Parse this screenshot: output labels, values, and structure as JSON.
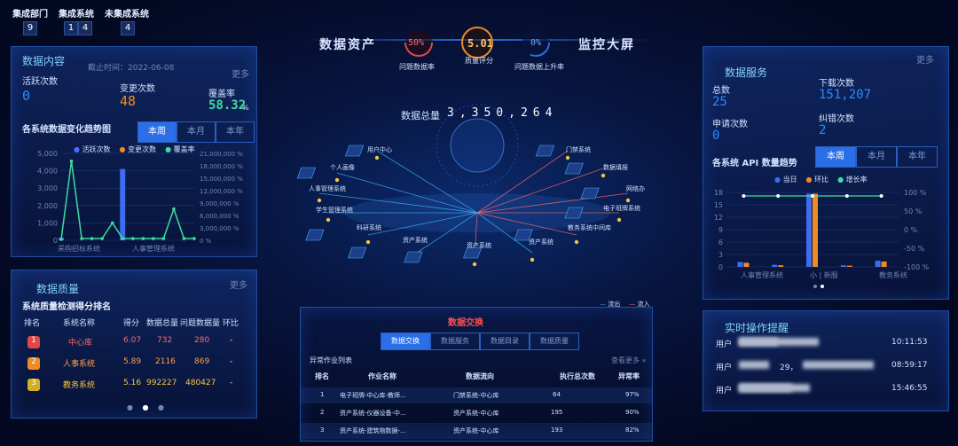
{
  "colors": {
    "accent": "#2a6fe8",
    "cyan": "#7fd4ff",
    "orange": "#f08a24",
    "green": "#3fdca0",
    "red": "#e04848",
    "yellow": "#f5c542"
  },
  "top_stats": {
    "labels": [
      "集成部门",
      "集成系统",
      "未集成系统"
    ],
    "dept_count": "9",
    "system_digits": [
      "1",
      "4"
    ],
    "unintegrated": "4"
  },
  "header": {
    "left_title": "数据资产",
    "right_title": "监控大屏",
    "gauges": [
      {
        "value": "50%",
        "label": "问题数据率"
      },
      {
        "value": "5.01",
        "label": "质量评分"
      },
      {
        "value": "0%",
        "label": "问题数据上升率"
      }
    ]
  },
  "data_content": {
    "title": "数据内容",
    "date": "截止时间：2022-06-08",
    "more": "更多",
    "active_label": "活跃次数",
    "active_value": "0",
    "change_label": "变更次数",
    "change_value": "48",
    "coverage_label": "覆盖率",
    "coverage_value": "58.32",
    "coverage_unit": "%",
    "trend_title": "各系统数据变化趋势图",
    "tabs": [
      "本周",
      "本月",
      "本年"
    ],
    "legend": [
      "活跃次数",
      "变更次数",
      "覆盖率"
    ]
  },
  "chart_data": [
    {
      "type": "line",
      "title": "各系统数据变化趋势图",
      "y_ticks_left": [
        "5,000",
        "4,000",
        "3,000",
        "2,000",
        "1,000",
        "0"
      ],
      "y_ticks_right": [
        "21,000,000 %",
        "18,000,000 %",
        "15,000,000 %",
        "12,000,000 %",
        "9,000,000 %",
        "6,000,000 %",
        "3,000,000 %",
        "0 %"
      ],
      "x_labels": [
        "采购招标系统",
        "人事管理系统"
      ],
      "ylim": [
        0,
        5000
      ],
      "series": [
        {
          "name": "活跃次数",
          "type": "bar",
          "values": [
            0,
            0,
            0,
            0,
            0,
            0,
            0,
            0,
            0,
            0,
            0,
            0,
            0,
            0
          ]
        },
        {
          "name": "变更次数",
          "type": "bar",
          "values": [
            150,
            0,
            0,
            0,
            0,
            0,
            4100,
            0,
            0,
            0,
            0,
            0,
            0,
            0
          ]
        },
        {
          "name": "覆盖率",
          "type": "line",
          "values": [
            50,
            4550,
            100,
            100,
            100,
            1000,
            100,
            100,
            100,
            100,
            100,
            1800,
            100,
            100
          ]
        }
      ]
    },
    {
      "type": "bar",
      "title": "各系统 API 数量趋势",
      "y_ticks_left": [
        "18",
        "15",
        "12",
        "9",
        "6",
        "3",
        "0"
      ],
      "y_ticks_right": [
        "100 %",
        "50 %",
        "0 %",
        "-50 %",
        "-100 %"
      ],
      "x_labels": [
        "人事管理系统",
        "小 | 新服",
        "教务系统"
      ],
      "ylim": [
        0,
        18
      ],
      "series": [
        {
          "name": "当日",
          "values": [
            1.2,
            0.5,
            17.7,
            0.4,
            1.5
          ]
        },
        {
          "name": "环比",
          "values": [
            1.0,
            0.4,
            17.7,
            0.3,
            1.3
          ]
        },
        {
          "name": "增长率",
          "type": "line",
          "values": [
            100,
            100,
            100,
            100,
            100
          ]
        }
      ]
    }
  ],
  "quality": {
    "title": "数据质量",
    "more": "更多",
    "subtitle": "系统质量检测得分排名",
    "columns": [
      "排名",
      "系统名称",
      "得分",
      "数据总量",
      "问题数据量",
      "环比"
    ],
    "rows": [
      {
        "rank": "1",
        "name": "中心库",
        "score": "6.07",
        "total": "732",
        "issue": "280",
        "ratio": "-"
      },
      {
        "rank": "2",
        "name": "人事系统",
        "score": "5.89",
        "total": "2116",
        "issue": "869",
        "ratio": "-"
      },
      {
        "rank": "3",
        "name": "教务系统",
        "score": "5.16",
        "total": "992227",
        "issue": "480427",
        "ratio": "-"
      }
    ]
  },
  "center": {
    "total_label": "数据总量",
    "total_value": "3,350,264",
    "nodes": [
      "用户中心",
      "门禁系统",
      "个人画像",
      "数据填报",
      "人事管理系统",
      "网络办",
      "学生管理系统",
      "电子班牌系统",
      "科研系统",
      "教务系统中间库",
      "资产系统",
      "资产系统",
      "资产系统",
      "资产系统"
    ],
    "legend": [
      "流出",
      "流入"
    ]
  },
  "bottom": {
    "banner": "数据交换",
    "tabs": [
      "数据交换",
      "数据服务",
      "数据目录",
      "数据质量"
    ],
    "list_title": "异常作业列表",
    "more": "查看更多 »",
    "columns": [
      "排名",
      "作业名称",
      "数据流向",
      "执行总次数",
      "异常率"
    ],
    "rows": [
      {
        "rank": "1",
        "name": "电子班牌-中心库-教师...",
        "flow": "门禁系统-中心库",
        "count": "64",
        "rate": "97%"
      },
      {
        "rank": "2",
        "name": "资产系统-仪器设备-中...",
        "flow": "资产系统-中心库",
        "count": "195",
        "rate": "90%"
      },
      {
        "rank": "3",
        "name": "资产系统-建筑物数据-...",
        "flow": "资产系统-中心库",
        "count": "193",
        "rate": "82%"
      }
    ]
  },
  "service": {
    "title": "数据服务",
    "more": "更多",
    "total_label": "总数",
    "total_value": "25",
    "download_label": "下载次数",
    "download_value": "151,207",
    "apply_label": "申请次数",
    "apply_value": "0",
    "error_label": "纠错次数",
    "error_value": "2",
    "api_title": "各系统 API 数量趋势",
    "tabs": [
      "本周",
      "本月",
      "本年"
    ],
    "legend": [
      "当日",
      "环比",
      "增长率"
    ]
  },
  "ops": {
    "title": "实时操作提醒",
    "rows": [
      {
        "user": "用户",
        "time": "10:11:53"
      },
      {
        "user": "用户",
        "mid": "29，",
        "time": "08:59:17"
      },
      {
        "user": "用户",
        "time": "15:46:55"
      }
    ]
  }
}
